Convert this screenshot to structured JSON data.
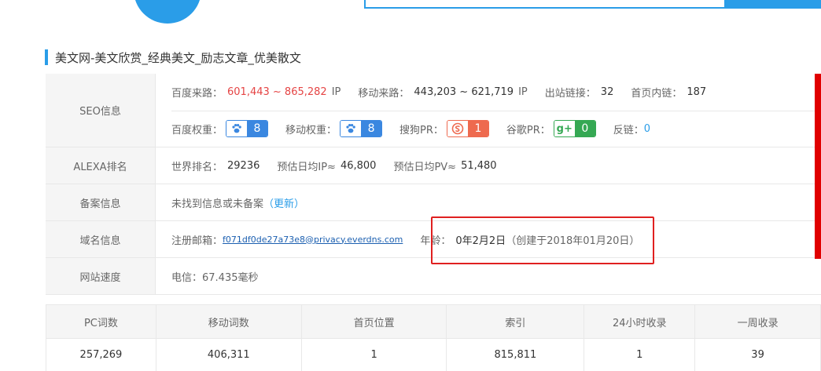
{
  "site": {
    "title": "美文网-美文欣赏_经典美文_励志文章_优美散文"
  },
  "seo": {
    "label": "SEO信息",
    "baidu_source_key": "百度来路：",
    "baidu_source_val": "601,443 ~ 865,282",
    "baidu_source_unit": "IP",
    "mobile_source_key": "移动来路：",
    "mobile_source_val": "443,203 ~ 621,719",
    "mobile_source_unit": "IP",
    "outlinks_key": "出站链接：",
    "outlinks_val": "32",
    "homelinks_key": "首页内链：",
    "homelinks_val": "187",
    "baidu_weight_key": "百度权重：",
    "baidu_weight_val": "8",
    "mobile_weight_key": "移动权重：",
    "mobile_weight_val": "8",
    "sogou_pr_key": "搜狗PR：",
    "sogou_pr_val": "1",
    "google_pr_key": "谷歌PR：",
    "google_pr_val": "0",
    "backlinks_key": "反链：",
    "backlinks_val": "0",
    "google_icon_text": "g+"
  },
  "alexa": {
    "label": "ALEXA排名",
    "world_rank_key": "世界排名：",
    "world_rank_val": "29236",
    "est_ip_key": "预估日均IP≈",
    "est_ip_val": "46,800",
    "est_pv_key": "预估日均PV≈",
    "est_pv_val": "51,480"
  },
  "icp": {
    "label": "备案信息",
    "text": "未找到信息或未备案",
    "update_link": "（更新）"
  },
  "domain": {
    "label": "域名信息",
    "email_key": "注册邮箱：",
    "email_val": "f071df0de27a73e8@privacy.everdns.com",
    "age_key": "年龄：",
    "age_val": "0年2月2日",
    "created": "（创建于2018年01月20日）"
  },
  "speed": {
    "label": "网站速度",
    "text": "电信：67.435毫秒"
  },
  "stats": {
    "headers": [
      "PC词数",
      "移动词数",
      "首页位置",
      "索引",
      "24小时收录",
      "一周收录"
    ],
    "values": [
      "257,269",
      "406,311",
      "1",
      "815,811",
      "1",
      "39"
    ]
  },
  "colors": {
    "accent": "#2a9de8",
    "highlight": "#e02020"
  }
}
